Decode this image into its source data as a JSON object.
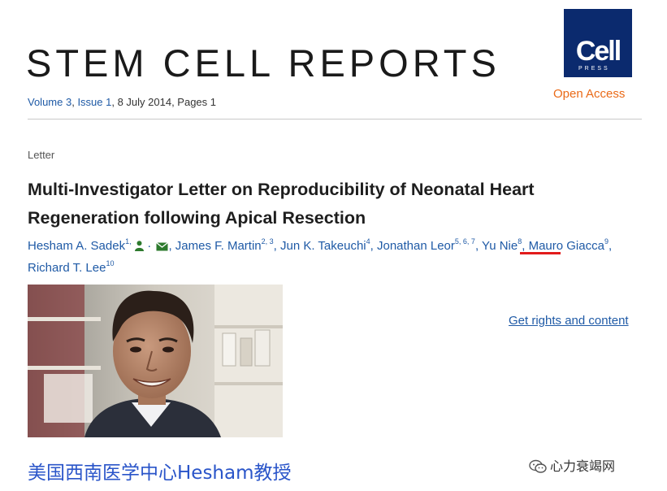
{
  "header": {
    "journal_title": "STEM CELL REPORTS",
    "logo_text": "Cell",
    "logo_press": "PRESS",
    "open_access": "Open Access",
    "citation": {
      "volume": "Volume 3",
      "sep1": ", ",
      "issue": "Issue 1",
      "rest": ", 8 July 2014, Pages 1"
    }
  },
  "article": {
    "type": "Letter",
    "title": "Multi-Investigator Letter on Reproducibility of Neonatal Heart Regeneration following Apical Resection",
    "authors": [
      {
        "name": "Hesham A. Sadek",
        "sup": "1, "
      },
      {
        "name": "James F. Martin",
        "sup": "2, 3"
      },
      {
        "name": "Jun K. Takeuchi",
        "sup": "4"
      },
      {
        "name": "Jonathan Leor",
        "sup": "5, 6, 7"
      },
      {
        "name": "Yu Nie",
        "sup": "8"
      },
      {
        "name": "Mauro Giacca",
        "sup": "9"
      },
      {
        "name": "Richard T. Lee",
        "sup": "10"
      }
    ],
    "separator": ", ",
    "rights_link": "Get rights and content"
  },
  "caption": "美国西南医学中心Hesham教授",
  "watermark": "心力衰竭网",
  "colors": {
    "link": "#1f5aa6",
    "accent_orange": "#ea6a17",
    "logo_bg": "#0b2a6e",
    "highlight_red": "#e21b1b",
    "caption_blue": "#2a55c9"
  },
  "icons": [
    "person-icon",
    "email-icon",
    "wechat-icon"
  ]
}
